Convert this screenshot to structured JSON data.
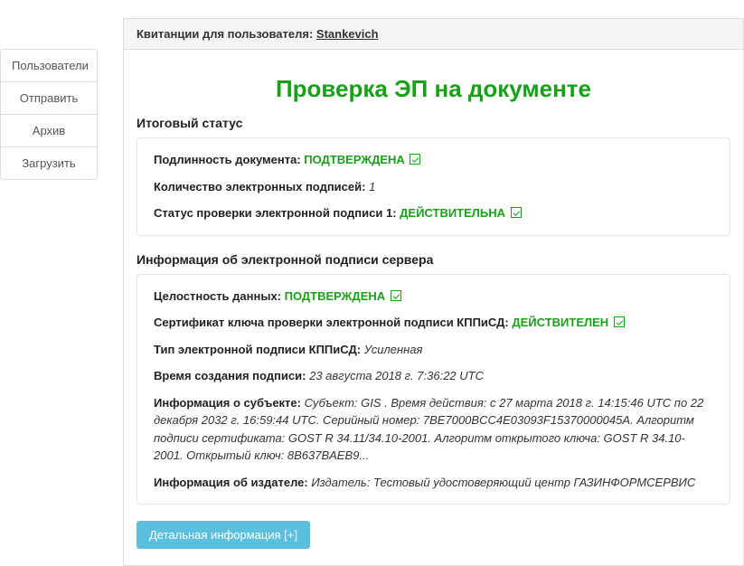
{
  "sidebar": {
    "items": [
      {
        "label": "Пользователи"
      },
      {
        "label": "Отправить"
      },
      {
        "label": "Архив"
      },
      {
        "label": "Загрузить"
      }
    ]
  },
  "header": {
    "prefix": "Квитанции для пользователя:",
    "user": "Stankevich"
  },
  "title": "Проверка ЭП на документе",
  "section1": {
    "heading": "Итоговый статус",
    "r1_label": "Подлинность документа:",
    "r1_status": "ПОДТВЕРЖДЕНА",
    "r2_label": "Количество электронных подписей:",
    "r2_value": "1",
    "r3_label": "Статус проверки электронной подписи 1:",
    "r3_status": "ДЕЙСТВИТЕЛЬНА"
  },
  "section2": {
    "heading": "Информация об электронной подписи сервера",
    "r1_label": "Целостность данных:",
    "r1_status": "ПОДТВЕРЖДЕНА",
    "r2_label": "Сертификат ключа проверки электронной подписи КППиСД:",
    "r2_status": "ДЕЙСТВИТЕЛЕН",
    "r3_label": "Тип электронной подписи КППиСД:",
    "r3_value": "Усиленная",
    "r4_label": "Время создания подписи:",
    "r4_value": "23 августа 2018 г. 7:36:22 UTC",
    "r5_label": "Информация о субъекте:",
    "r5_value": "Субъект: GIS . Время действия: с 27 марта 2018 г. 14:15:46 UTC по 22 декабря 2032 г. 16:59:44 UTC. Серийный номер: 7BE7000BCC4E03093F15370000045A. Алгоритм подписи сертификата: GOST R 34.11/34.10-2001. Алгоритм открытого ключа: GOST R 34.10-2001. Открытый ключ: 8B637BAEB9...",
    "r6_label": "Информация об издателе:",
    "r6_value": "Издатель: Тестовый удостоверяющий центр ГАЗИНФОРМСЕРВИС"
  },
  "detail_button": "Детальная информация [+]"
}
